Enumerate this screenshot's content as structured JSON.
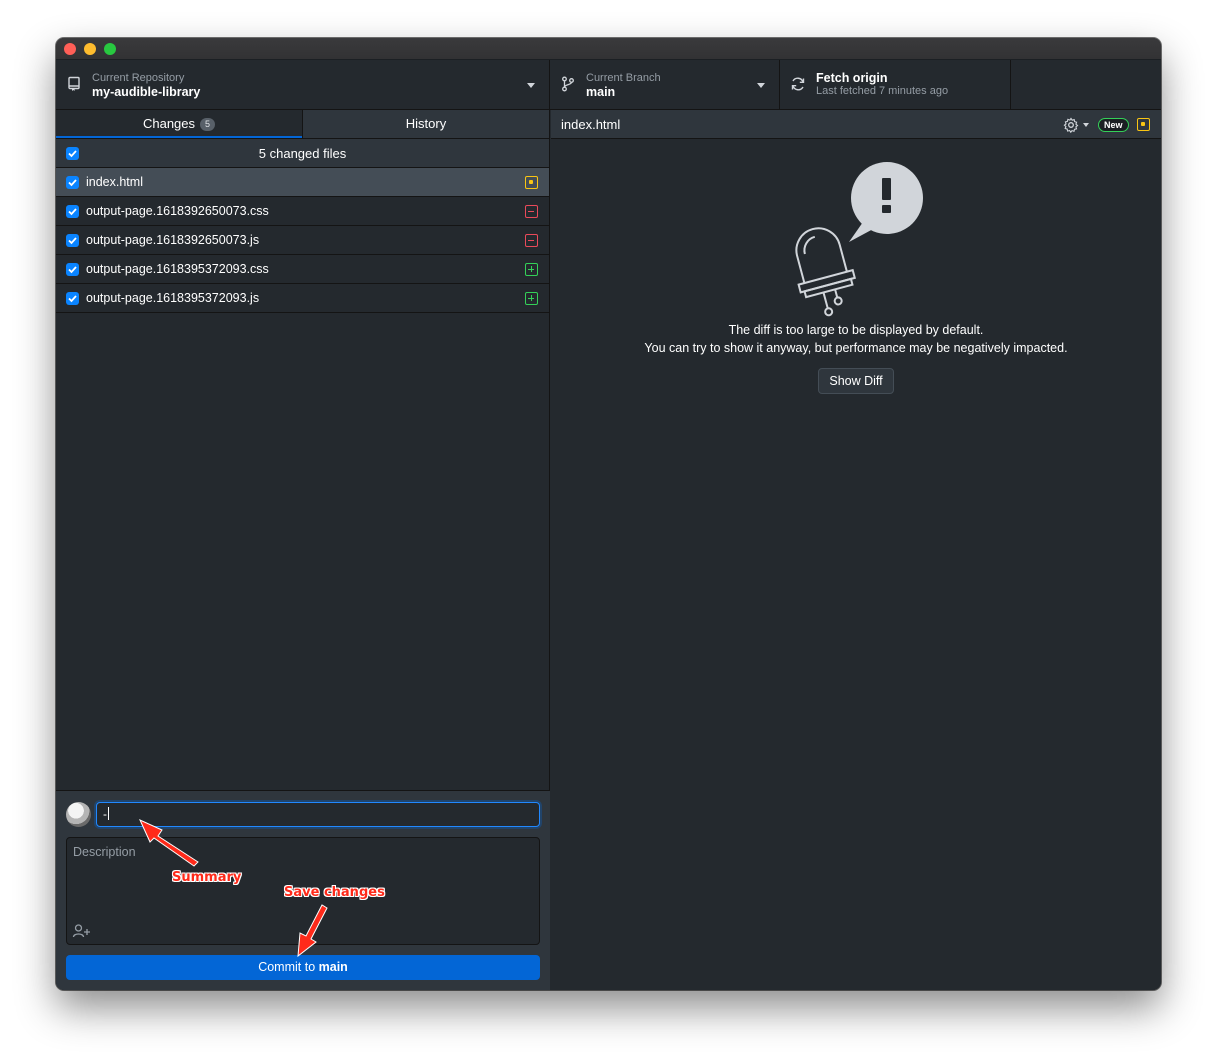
{
  "toolbar": {
    "repo_label": "Current Repository",
    "repo_name": "my-audible-library",
    "branch_label": "Current Branch",
    "branch_name": "main",
    "fetch_title": "Fetch origin",
    "fetch_status": "Last fetched 7 minutes ago"
  },
  "tabs": {
    "changes": "Changes",
    "changes_count": "5",
    "history": "History"
  },
  "changes": {
    "header": "5 changed files",
    "files": [
      {
        "name": "index.html",
        "status": "modified"
      },
      {
        "name": "output-page.1618392650073.css",
        "status": "deleted"
      },
      {
        "name": "output-page.1618392650073.js",
        "status": "deleted"
      },
      {
        "name": "output-page.1618395372093.css",
        "status": "added"
      },
      {
        "name": "output-page.1618395372093.js",
        "status": "added"
      }
    ]
  },
  "commit": {
    "summary_value": "-",
    "description_placeholder": "Description",
    "button_prefix": "Commit to ",
    "button_branch": "main"
  },
  "diff": {
    "file": "index.html",
    "new_badge": "New",
    "message_line1": "The diff is too large to be displayed by default.",
    "message_line2": "You can try to show it anyway, but performance may be negatively impacted.",
    "show_diff_label": "Show Diff"
  },
  "annotations": {
    "summary": "Summary",
    "save_changes": "Save changes"
  },
  "colors": {
    "accent": "#0366d6",
    "modified": "#f9c513",
    "deleted": "#ea4a5a",
    "added": "#34d058",
    "annotation": "#ff2a1a"
  }
}
